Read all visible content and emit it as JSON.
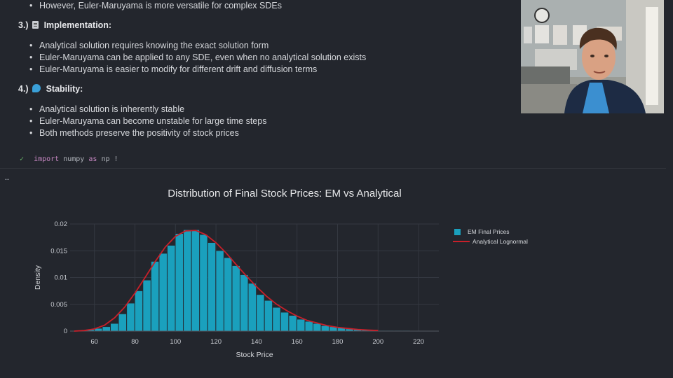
{
  "notes": {
    "top_bullet": "However, Euler-Maruyama is more versatile for complex SDEs",
    "sections": [
      {
        "heading": "3.)",
        "icon": "document-icon",
        "title": "Implementation:",
        "bullets": [
          "Analytical solution requires knowing the exact solution form",
          "Euler-Maruyama can be applied to any SDE, even when no analytical solution exists",
          "Euler-Maruyama is easier to modify for different drift and diffusion terms"
        ]
      },
      {
        "heading": "4.)",
        "icon": "wave-icon",
        "title": "Stability:",
        "bullets": [
          "Analytical solution is inherently stable",
          "Euler-Maruyama can become unstable for large time steps",
          "Both methods preserve the positivity of stock prices"
        ]
      }
    ]
  },
  "code_cell": {
    "status": "✓",
    "keyword1": "import",
    "module": "numpy",
    "keyword2": "as",
    "alias": "np",
    "more": "!"
  },
  "output_marker": "...",
  "chart_data": {
    "type": "bar",
    "title": "Distribution of Final Stock Prices: EM vs Analytical",
    "xlabel": "Stock Price",
    "ylabel": "Density",
    "xlim": [
      48,
      230
    ],
    "ylim": [
      0,
      0.02
    ],
    "x_ticks": [
      60,
      80,
      100,
      120,
      140,
      160,
      180,
      200,
      220
    ],
    "y_ticks": [
      0,
      0.005,
      0.01,
      0.015,
      0.02
    ],
    "y_tick_labels": [
      "0",
      "0.005",
      "0.01",
      "0.015",
      "0.02"
    ],
    "legend_position": "top-right",
    "series": [
      {
        "name": "EM Final Prices",
        "kind": "histogram",
        "color": "#1aa0bd",
        "bin_width": 4,
        "bin_starts": [
          52,
          56,
          60,
          64,
          68,
          72,
          76,
          80,
          84,
          88,
          92,
          96,
          100,
          104,
          108,
          112,
          116,
          120,
          124,
          128,
          132,
          136,
          140,
          144,
          148,
          152,
          156,
          160,
          164,
          168,
          172,
          176,
          180,
          184,
          188,
          192,
          196,
          200,
          204,
          208,
          212,
          216,
          220,
          224
        ],
        "values": [
          0.0001,
          0.0003,
          0.0005,
          0.0008,
          0.0014,
          0.0032,
          0.0052,
          0.0075,
          0.0095,
          0.013,
          0.0145,
          0.016,
          0.0182,
          0.0189,
          0.0189,
          0.018,
          0.0165,
          0.015,
          0.0137,
          0.0122,
          0.0105,
          0.0089,
          0.0068,
          0.0057,
          0.0044,
          0.0035,
          0.0029,
          0.0022,
          0.0018,
          0.0014,
          0.001,
          0.0008,
          0.0006,
          0.0004,
          0.0003,
          0.0002,
          0.0002,
          0.0001,
          0.0001,
          0.0001,
          0.0001,
          5e-05,
          5e-05,
          5e-05
        ]
      },
      {
        "name": "Analytical Lognormal",
        "kind": "line",
        "color": "#c8202a",
        "x": [
          50,
          55,
          60,
          65,
          70,
          75,
          80,
          85,
          90,
          95,
          100,
          105,
          110,
          115,
          120,
          125,
          130,
          135,
          140,
          145,
          150,
          155,
          160,
          165,
          170,
          175,
          180,
          185,
          190,
          195,
          200
        ],
        "values": [
          0.0,
          0.0001,
          0.0004,
          0.0011,
          0.0025,
          0.0045,
          0.0071,
          0.01,
          0.013,
          0.0157,
          0.0177,
          0.0187,
          0.0188,
          0.018,
          0.0165,
          0.0146,
          0.0124,
          0.0103,
          0.0083,
          0.0065,
          0.005,
          0.0038,
          0.0028,
          0.002,
          0.0015,
          0.001,
          0.0007,
          0.0005,
          0.0003,
          0.0002,
          0.0001
        ]
      }
    ]
  },
  "colors": {
    "background": "#23262d",
    "bar": "#1aa0bd",
    "curve": "#c8202a"
  }
}
